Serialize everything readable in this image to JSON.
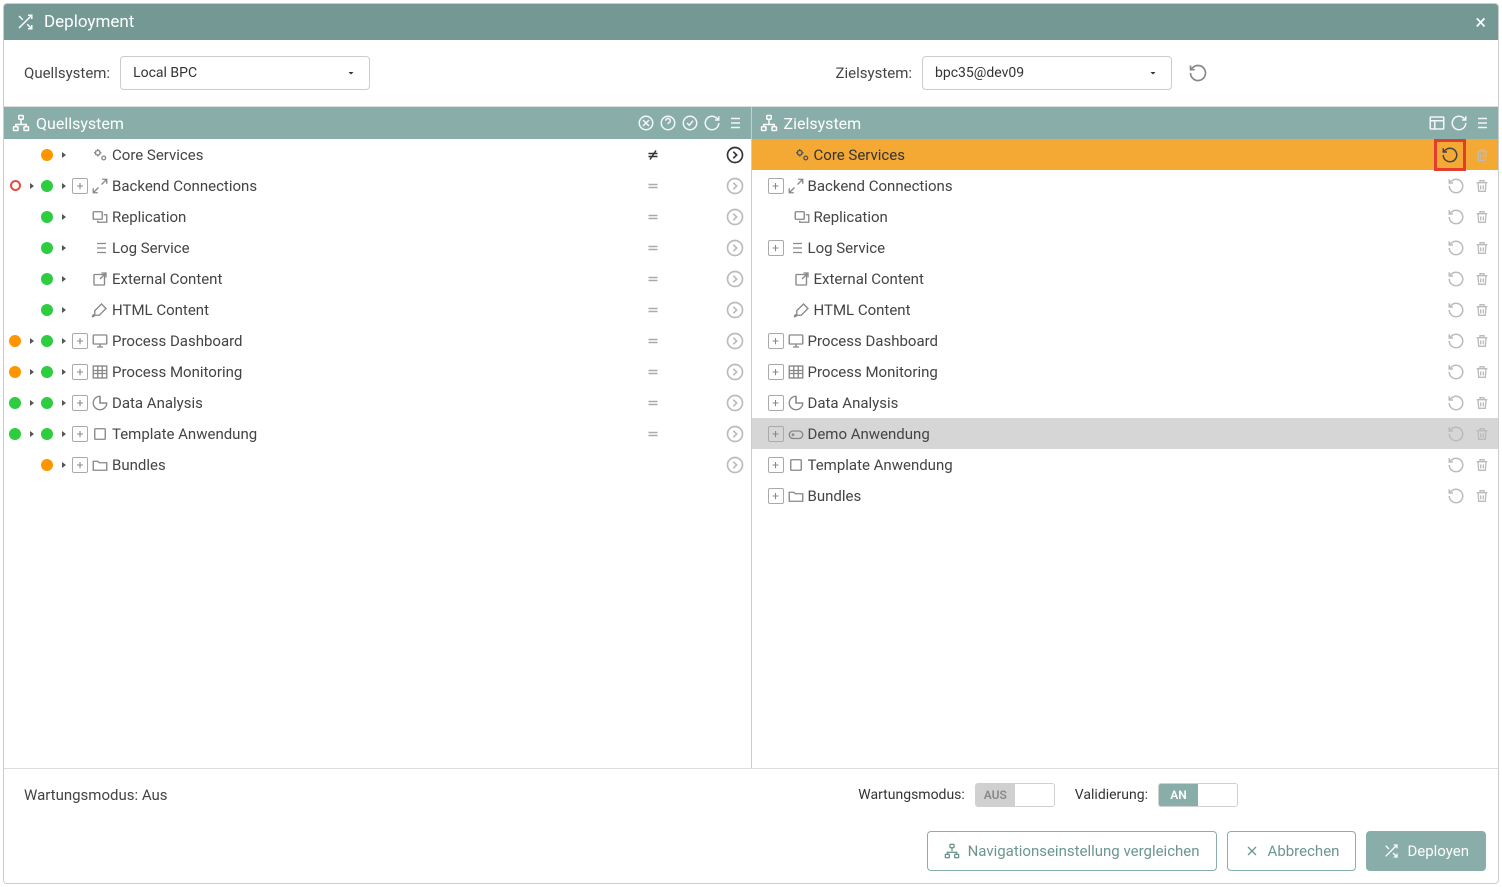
{
  "window": {
    "title": "Deployment"
  },
  "selectBar": {
    "quell_label": "Quellsystem:",
    "quell_value": "Local BPC",
    "ziel_label": "Zielsystem:",
    "ziel_value": "bpc35@dev09"
  },
  "panelLeft": {
    "title": "Quellsystem"
  },
  "panelRight": {
    "title": "Zielsystem"
  },
  "leftTree": [
    {
      "dot1": null,
      "dot2": "orange",
      "expand": false,
      "indent": 1,
      "icon": "gears",
      "label": "Core Services",
      "diff": "neq",
      "arrow": "act"
    },
    {
      "dot1": "red-outline",
      "dot2": "green",
      "expand": true,
      "indent": 0,
      "icon": "expand-arrows",
      "label": "Backend Connections",
      "diff": "eq",
      "arrow": "dim"
    },
    {
      "dot1": null,
      "dot2": "green",
      "expand": false,
      "indent": 1,
      "icon": "replication",
      "label": "Replication",
      "diff": "eq",
      "arrow": "dim"
    },
    {
      "dot1": null,
      "dot2": "green",
      "expand": false,
      "indent": 1,
      "icon": "list",
      "label": "Log Service",
      "diff": "eq",
      "arrow": "dim"
    },
    {
      "dot1": null,
      "dot2": "green",
      "expand": false,
      "indent": 1,
      "icon": "external",
      "label": "External Content",
      "diff": "eq",
      "arrow": "dim"
    },
    {
      "dot1": null,
      "dot2": "green",
      "expand": false,
      "indent": 1,
      "icon": "brush",
      "label": "HTML Content",
      "diff": "eq",
      "arrow": "dim"
    },
    {
      "dot1": "orange",
      "dot2": "green",
      "expand": true,
      "indent": 0,
      "icon": "monitor",
      "label": "Process Dashboard",
      "diff": "eq",
      "arrow": "dim"
    },
    {
      "dot1": "orange",
      "dot2": "green",
      "expand": true,
      "indent": 0,
      "icon": "grid",
      "label": "Process Monitoring",
      "diff": "eq",
      "arrow": "dim"
    },
    {
      "dot1": "green",
      "dot2": "green",
      "expand": true,
      "indent": 0,
      "icon": "pie",
      "label": "Data Analysis",
      "diff": "eq",
      "arrow": "dim"
    },
    {
      "dot1": "green",
      "dot2": "green",
      "expand": true,
      "indent": 0,
      "icon": "square",
      "label": "Template Anwendung",
      "diff": "eq",
      "arrow": "dim"
    },
    {
      "dot1": null,
      "dot2": "orange",
      "expand": true,
      "indent": 0,
      "icon": "folder",
      "label": "Bundles",
      "diff": null,
      "arrow": "dim"
    }
  ],
  "rightTree": [
    {
      "expand": false,
      "indent": 1,
      "icon": "gears",
      "label": "Core Services",
      "state": "selected",
      "redbox": true
    },
    {
      "expand": true,
      "indent": 0,
      "icon": "expand-arrows",
      "label": "Backend Connections",
      "state": ""
    },
    {
      "expand": false,
      "indent": 1,
      "icon": "replication",
      "label": "Replication",
      "state": ""
    },
    {
      "expand": true,
      "indent": 0,
      "icon": "list",
      "label": "Log Service",
      "state": ""
    },
    {
      "expand": false,
      "indent": 1,
      "icon": "external",
      "label": "External Content",
      "state": ""
    },
    {
      "expand": false,
      "indent": 1,
      "icon": "brush",
      "label": "HTML Content",
      "state": ""
    },
    {
      "expand": true,
      "indent": 0,
      "icon": "monitor",
      "label": "Process Dashboard",
      "state": ""
    },
    {
      "expand": true,
      "indent": 0,
      "icon": "grid",
      "label": "Process Monitoring",
      "state": ""
    },
    {
      "expand": true,
      "indent": 0,
      "icon": "pie",
      "label": "Data Analysis",
      "state": ""
    },
    {
      "expand": true,
      "indent": 0,
      "icon": "gamepad",
      "label": "Demo Anwendung",
      "state": "dimmed"
    },
    {
      "expand": true,
      "indent": 0,
      "icon": "square",
      "label": "Template Anwendung",
      "state": ""
    },
    {
      "expand": true,
      "indent": 0,
      "icon": "folder",
      "label": "Bundles",
      "state": ""
    }
  ],
  "footer": {
    "status_left": "Wartungsmodus: Aus",
    "wartungs_label": "Wartungsmodus:",
    "wartungs_state": "AUS",
    "valid_label": "Validierung:",
    "valid_state": "AN",
    "btn_nav": "Navigationseinstellung vergleichen",
    "btn_cancel": "Abbrechen",
    "btn_deploy": "Deployen"
  }
}
